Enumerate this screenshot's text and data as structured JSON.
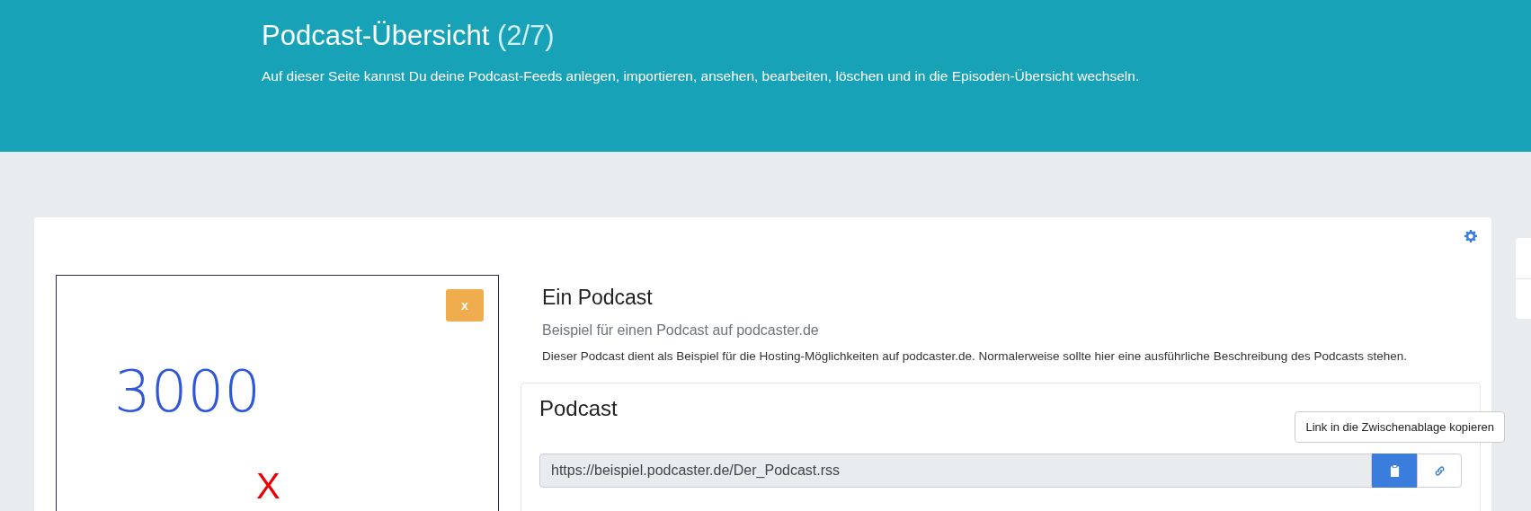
{
  "header": {
    "title": "Podcast-Übersicht",
    "count": "(2/7)",
    "description": "Auf dieser Seite kannst Du deine Podcast-Feeds anlegen, importieren, ansehen, bearbeiten, löschen und in die Episoden-Übersicht wechseln."
  },
  "podcast": {
    "image": {
      "number": "3000",
      "mark": "X",
      "remove_button": "x"
    },
    "name": "Ein Podcast",
    "subtitle": "Beispiel für einen Podcast auf podcaster.de",
    "description": "Dieser Podcast dient als Beispiel für die Hosting-Möglichkeiten auf podcaster.de. Normalerweise sollte hier eine ausführliche Beschreibung des Podcasts stehen.",
    "feed": {
      "heading": "Podcast",
      "url": "https://beispiel.podcaster.de/Der_Podcast.rss",
      "tooltip": "Link in die Zwischenablage kopieren"
    }
  }
}
